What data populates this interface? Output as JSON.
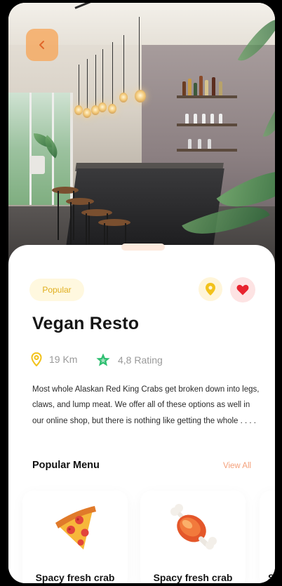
{
  "restaurant": {
    "badge": "Popular",
    "name": "Vegan Resto",
    "distance": "19 Km",
    "rating": "4,8 Rating",
    "description": "Most whole Alaskan Red King Crabs get broken down into legs, claws, and lump meat. We offer all of these options as well in our online shop, but there is nothing like getting the whole . . . ."
  },
  "menu": {
    "title": "Popular Menu",
    "view_all": "View All",
    "items": [
      {
        "label": "Spacy fresh crab",
        "icon": "pizza-icon"
      },
      {
        "label": "Spacy fresh crab",
        "icon": "meat-icon"
      },
      {
        "label": "S",
        "icon": ""
      }
    ]
  },
  "icons": {
    "back": "chevron-left-icon",
    "location": "location-pin-icon",
    "favorite": "heart-icon",
    "distance": "map-pin-icon",
    "rating": "star-icon"
  },
  "colors": {
    "accent_orange": "#f6a85c",
    "badge_yellow": "#e0ae1e",
    "heart_red": "#e8232f",
    "star_green": "#2fbf71",
    "view_all": "#f4a07a"
  }
}
